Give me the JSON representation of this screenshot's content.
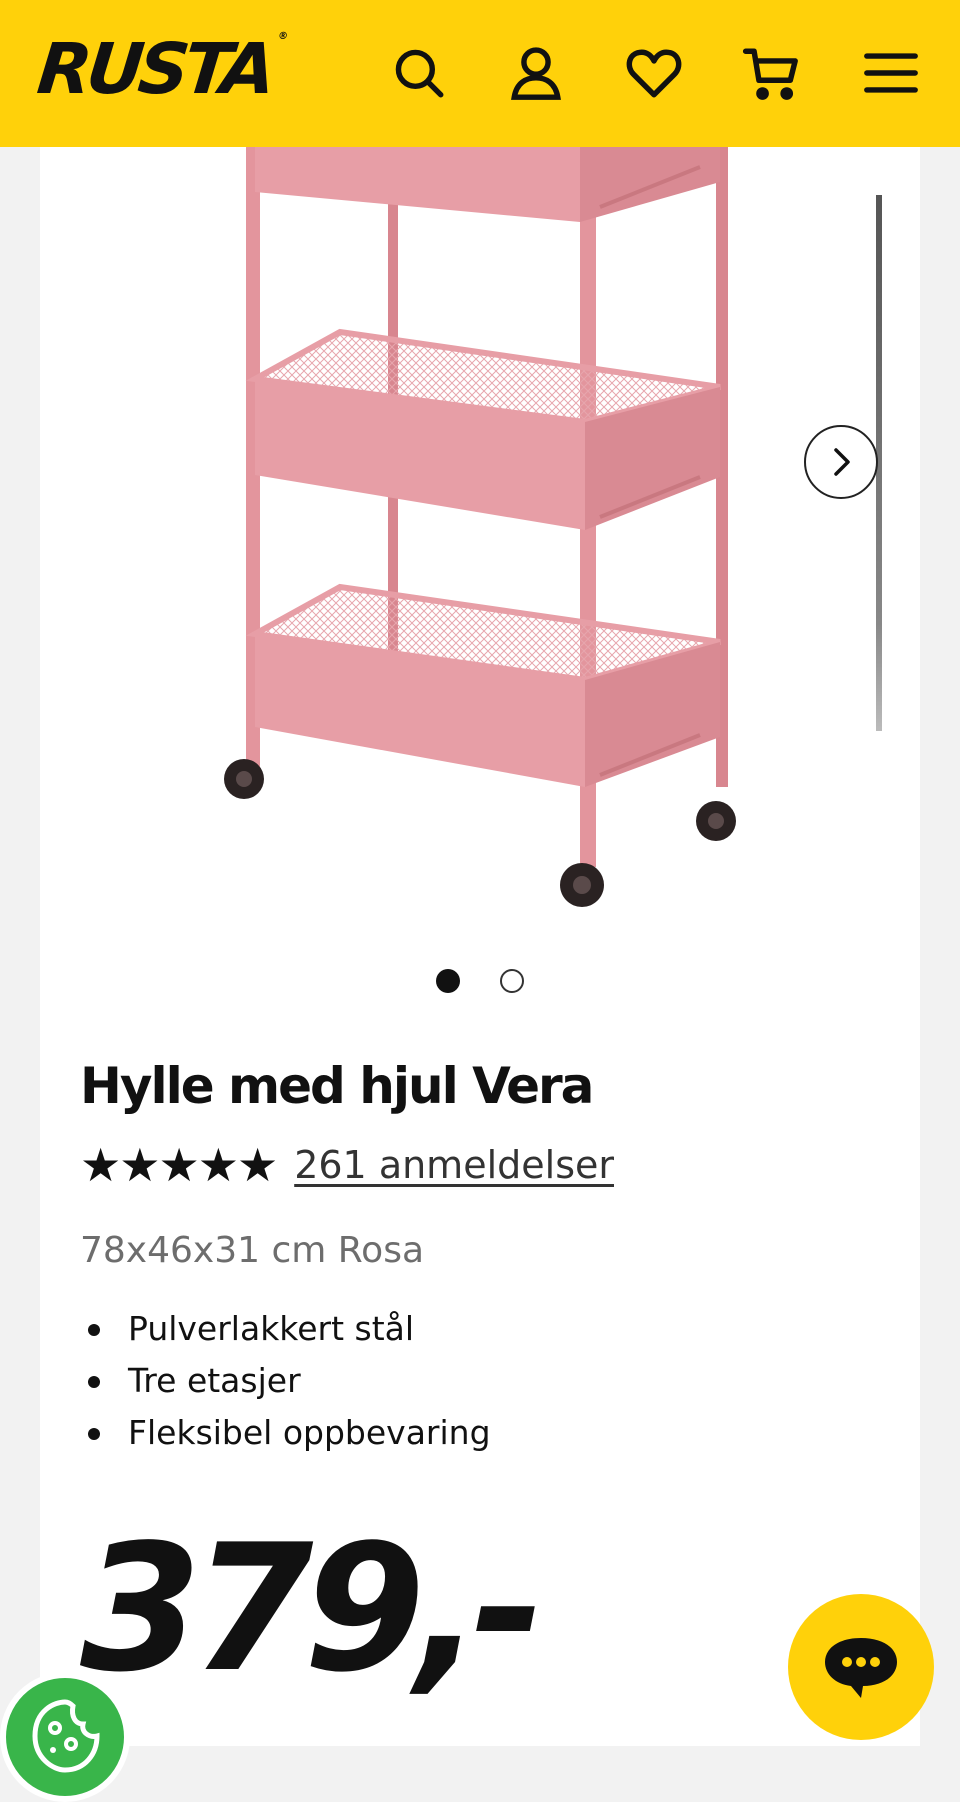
{
  "header": {
    "logo_text": "RUSTA",
    "logo_mark": "®",
    "icons": [
      "search-icon",
      "account-icon",
      "heart-icon",
      "cart-icon",
      "menu-icon"
    ],
    "background": "#ffd10a"
  },
  "gallery": {
    "image": "pink-three-tier-rolling-cart",
    "current_slide": 1,
    "total_slides": 2,
    "next_icon": "chevron-right-icon"
  },
  "product": {
    "title": "Hylle med hjul Vera",
    "stars": "★★★★★",
    "rating": 5,
    "reviews_label": "261 anmeldelser",
    "variant": "78x46x31 cm Rosa",
    "features": [
      "Pulverlakkert stål",
      "Tre etasjer",
      "Fleksibel oppbevaring"
    ],
    "price": "379,-"
  },
  "chat": {
    "icon": "chat-bubble-icon",
    "color": "#ffd10a"
  },
  "cookie": {
    "icon": "cookie-icon",
    "color": "#39b54a"
  }
}
